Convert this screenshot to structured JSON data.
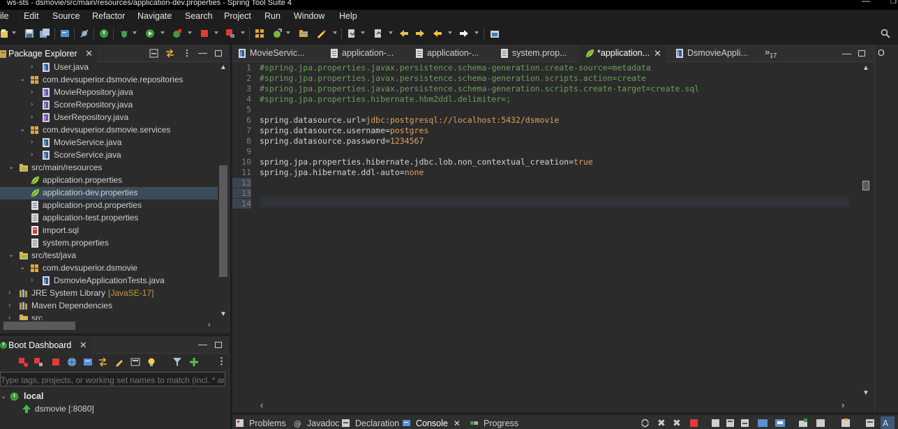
{
  "window": {
    "title": "ws-sts - dsmovie/src/main/resources/application-dev.properties - Spring Tool Suite 4",
    "minimize_glyph": "—",
    "maximize_glyph": "❐"
  },
  "menu": [
    "ile",
    "Edit",
    "Source",
    "Refactor",
    "Navigate",
    "Search",
    "Project",
    "Run",
    "Window",
    "Help"
  ],
  "package_explorer": {
    "title": "Package Explorer",
    "tree": [
      {
        "label": "User.java",
        "icon": "java-file-icon",
        "chev": "right"
      },
      {
        "label": "com.devsuperior.dsmovie.repositories",
        "icon": "package-icon",
        "chev": "down"
      },
      {
        "label": "MovieRepository.java",
        "icon": "java-interface-icon",
        "chev": "right"
      },
      {
        "label": "ScoreRepository.java",
        "icon": "java-interface-icon",
        "chev": "right"
      },
      {
        "label": "UserRepository.java",
        "icon": "java-interface-icon",
        "chev": "right"
      },
      {
        "label": "com.devsuperior.dsmovie.services",
        "icon": "package-icon",
        "chev": "down"
      },
      {
        "label": "MovieService.java",
        "icon": "java-file-icon",
        "chev": "right"
      },
      {
        "label": "ScoreService.java",
        "icon": "java-file-icon",
        "chev": "right"
      },
      {
        "label": "src/main/resources",
        "icon": "source-folder-icon",
        "chev": "down"
      },
      {
        "label": "application.properties",
        "icon": "spring-properties-icon",
        "chev": ""
      },
      {
        "label": "application-dev.properties",
        "icon": "spring-properties-icon",
        "chev": "",
        "selected": true
      },
      {
        "label": "application-prod.properties",
        "icon": "text-file-icon",
        "chev": ""
      },
      {
        "label": "application-test.properties",
        "icon": "text-file-icon",
        "chev": ""
      },
      {
        "label": "import.sql",
        "icon": "sql-file-icon",
        "chev": ""
      },
      {
        "label": "system.properties",
        "icon": "text-file-icon",
        "chev": ""
      },
      {
        "label": "src/test/java",
        "icon": "source-folder-icon",
        "chev": "down"
      },
      {
        "label": "com.devsuperior.dsmovie",
        "icon": "package-icon",
        "chev": "down"
      },
      {
        "label": "DsmovieApplicationTests.java",
        "icon": "java-file-icon",
        "chev": "right"
      },
      {
        "label": "JRE System Library",
        "suffix": "[JavaSE-17]",
        "icon": "library-icon",
        "chev": "right"
      },
      {
        "label": "Maven Dependencies",
        "icon": "library-icon",
        "chev": "right"
      },
      {
        "label": "src",
        "icon": "folder-icon",
        "chev": "right"
      }
    ]
  },
  "boot_dashboard": {
    "title": "Boot Dashboard",
    "search_placeholder": "Type tags, projects, or working set names to match (incl. * and",
    "local_label": "local",
    "app_label": "dsmovie [:8080]"
  },
  "editor": {
    "tabs": [
      {
        "label": "MovieServic...",
        "icon": "java-file-icon"
      },
      {
        "label": "application-...",
        "icon": "text-file-icon"
      },
      {
        "label": "application-...",
        "icon": "text-file-icon"
      },
      {
        "label": "system.prop...",
        "icon": "text-file-icon"
      },
      {
        "label": "*application...",
        "icon": "spring-properties-icon",
        "active": true
      },
      {
        "label": "DsmovieAppli...",
        "icon": "java-file-icon"
      }
    ],
    "overflow_label": "»",
    "overflow_count": "17",
    "lines": [
      {
        "n": "1",
        "parts": [
          {
            "t": "#spring.jpa.properties.javax.persistence.schema-generation.create-source=metadata",
            "c": "com"
          }
        ]
      },
      {
        "n": "2",
        "parts": [
          {
            "t": "#spring.jpa.properties.javax.persistence.schema-generation.scripts.action=create",
            "c": "com"
          }
        ]
      },
      {
        "n": "3",
        "parts": [
          {
            "t": "#spring.jpa.properties.javax.persistence.schema-generation.scripts.create-target=create.sql",
            "c": "com"
          }
        ]
      },
      {
        "n": "4",
        "parts": [
          {
            "t": "#spring.jpa.properties.hibernate.hbm2ddl.delimiter=;",
            "c": "com"
          }
        ]
      },
      {
        "n": "5",
        "parts": []
      },
      {
        "n": "6",
        "parts": [
          {
            "t": "spring.datasource.url=",
            "c": "key"
          },
          {
            "t": "jdbc:postgresql://localhost:5432/dsmovie",
            "c": "val"
          }
        ]
      },
      {
        "n": "7",
        "parts": [
          {
            "t": "spring.datasource.username=",
            "c": "key"
          },
          {
            "t": "postgres",
            "c": "val"
          }
        ]
      },
      {
        "n": "8",
        "parts": [
          {
            "t": "spring.datasource.password=",
            "c": "key"
          },
          {
            "t": "1234567",
            "c": "val"
          }
        ]
      },
      {
        "n": "9",
        "parts": []
      },
      {
        "n": "10",
        "parts": [
          {
            "t": "spring.jpa.properties.hibernate.jdbc.lob.non_contextual_creation=",
            "c": "key"
          },
          {
            "t": "true",
            "c": "val"
          }
        ]
      },
      {
        "n": "11",
        "parts": [
          {
            "t": "spring.jpa.hibernate.ddl-auto=",
            "c": "key"
          },
          {
            "t": "none",
            "c": "val"
          }
        ]
      },
      {
        "n": "12",
        "parts": [],
        "hl": true
      },
      {
        "n": "13",
        "parts": [],
        "hl": true
      },
      {
        "n": "14",
        "parts": [],
        "hl": true
      }
    ]
  },
  "right_rim_label": "O",
  "bottom_tabs": [
    {
      "label": "Problems",
      "icon": "problems-icon"
    },
    {
      "label": "Javadoc",
      "icon": "javadoc-icon"
    },
    {
      "label": "Declaration",
      "icon": "declaration-icon"
    },
    {
      "label": "Console",
      "icon": "console-icon",
      "active": true
    },
    {
      "label": "Progress",
      "icon": "progress-icon"
    }
  ],
  "colors": {
    "comment": "#6a9f59",
    "value": "#e0a060",
    "selection": "#3b4b59",
    "java_icon": "#4a7fc1",
    "spring_leaf": "#9bd14a"
  }
}
